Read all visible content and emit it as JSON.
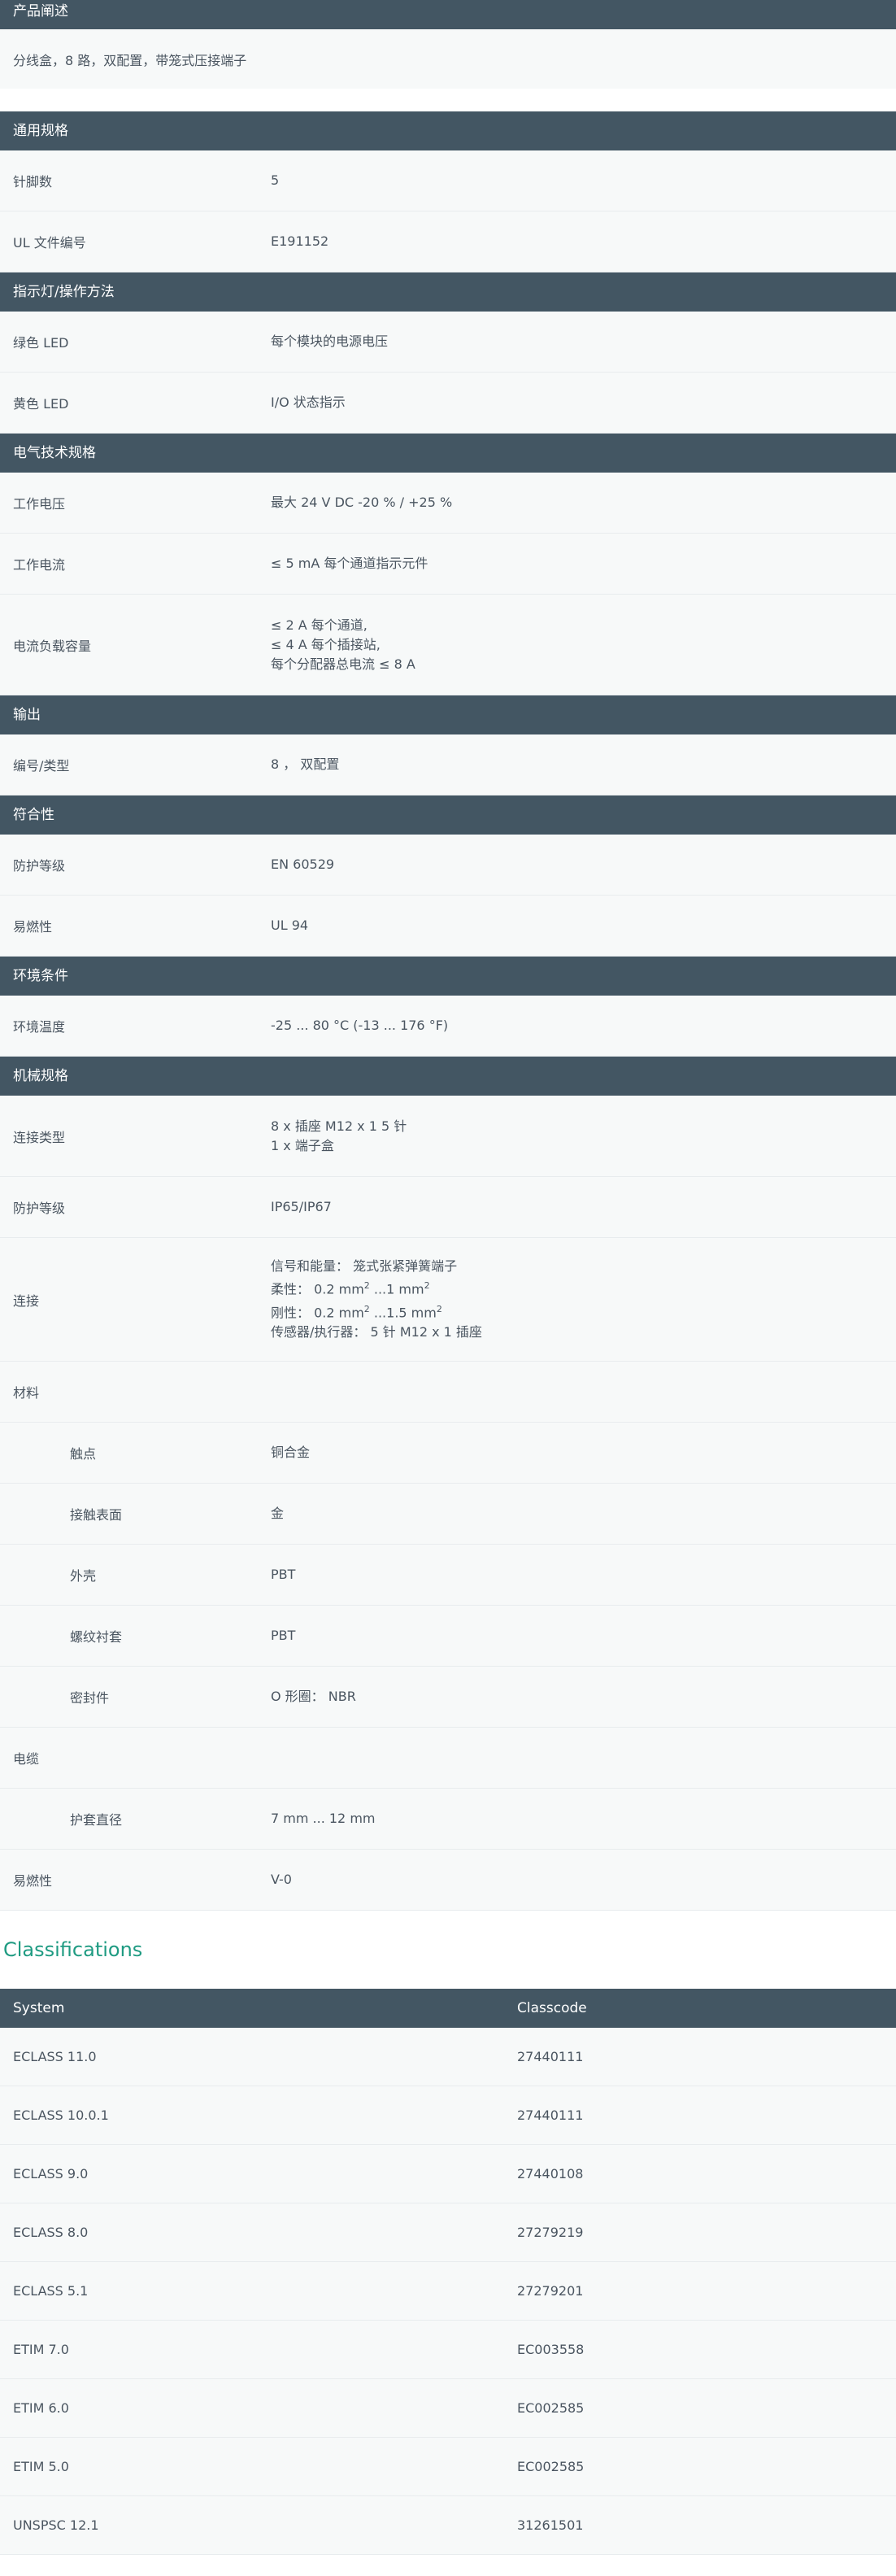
{
  "description": {
    "header": "产品阐述",
    "text": "分线盒，8 路，双配置，带笼式压接端子"
  },
  "general": {
    "header": "通用规格",
    "rows": [
      {
        "label": "针脚数",
        "value": "5"
      },
      {
        "label": "UL 文件编号",
        "value": "E191152"
      }
    ]
  },
  "indicators": {
    "header": "指示灯/操作方法",
    "rows": [
      {
        "label": "绿色 LED",
        "value": "每个模块的电源电压"
      },
      {
        "label": "黄色 LED",
        "value": "I/O 状态指示"
      }
    ]
  },
  "electrical": {
    "header": "电气技术规格",
    "rows": [
      {
        "label": "工作电压",
        "value": "最大 24 V DC -20 % / +25 %"
      },
      {
        "label": "工作电流",
        "value": "≤ 5 mA 每个通道指示元件"
      }
    ],
    "load": {
      "label": "电流负载容量",
      "lines": [
        "≤ 2 A 每个通道,",
        "≤ 4 A 每个插接站,",
        "每个分配器总电流 ≤ 8 A"
      ]
    }
  },
  "output": {
    "header": "输出",
    "rows": [
      {
        "label": "编号/类型",
        "value": "8 ， 双配置"
      }
    ]
  },
  "conformity": {
    "header": "符合性",
    "rows": [
      {
        "label": "防护等级",
        "value": "EN 60529"
      },
      {
        "label": "易燃性",
        "value": "UL 94"
      }
    ]
  },
  "environment": {
    "header": "环境条件",
    "rows": [
      {
        "label": "环境温度",
        "value": "-25 ... 80 °C (-13 ... 176 °F)"
      }
    ]
  },
  "mechanical": {
    "header": "机械规格",
    "connection_type": {
      "label": "连接类型",
      "lines": [
        "8 x 插座 M12 x 1 5 针",
        "1 x 端子盒"
      ]
    },
    "protection": {
      "label": "防护等级",
      "value": "IP65/IP67"
    },
    "connection": {
      "label": "连接",
      "line1": "信号和能量： 笼式张紧弹簧端子",
      "line2_prefix": "柔性： 0.2 mm",
      "line2_mid": " ...1 mm",
      "line3_prefix": "刚性： 0.2 mm",
      "line3_mid": " ...1.5 mm",
      "sup": "2",
      "line4": "传感器/执行器： 5 针 M12 x 1 插座"
    },
    "material": {
      "label": "材料",
      "items": [
        {
          "label": "触点",
          "value": "铜合金"
        },
        {
          "label": "接触表面",
          "value": "金"
        },
        {
          "label": "外壳",
          "value": "PBT"
        },
        {
          "label": "螺纹衬套",
          "value": "PBT"
        },
        {
          "label": "密封件",
          "value": "O 形圈： NBR"
        }
      ]
    },
    "cable": {
      "label": "电缆",
      "items": [
        {
          "label": "护套直径",
          "value": "7 mm ... 12 mm"
        }
      ]
    },
    "flammability": {
      "label": "易燃性",
      "value": "V-0"
    }
  },
  "classifications": {
    "title": "Classifications",
    "col_system": "System",
    "col_classcode": "Classcode",
    "rows": [
      {
        "system": "ECLASS 11.0",
        "code": "27440111"
      },
      {
        "system": "ECLASS 10.0.1",
        "code": "27440111"
      },
      {
        "system": "ECLASS 9.0",
        "code": "27440108"
      },
      {
        "system": "ECLASS 8.0",
        "code": "27279219"
      },
      {
        "system": "ECLASS 5.1",
        "code": "27279201"
      },
      {
        "system": "ETIM 7.0",
        "code": "EC003558"
      },
      {
        "system": "ETIM 6.0",
        "code": "EC002585"
      },
      {
        "system": "ETIM 5.0",
        "code": "EC002585"
      },
      {
        "system": "UNSPSC 12.1",
        "code": "31261501"
      }
    ]
  }
}
